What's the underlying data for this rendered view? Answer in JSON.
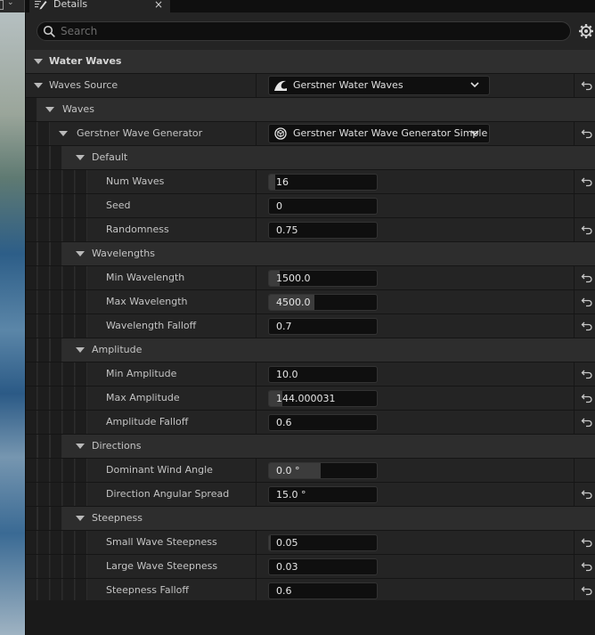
{
  "tab": {
    "title": "Details",
    "close": "×"
  },
  "search": {
    "placeholder": "Search"
  },
  "categories": {
    "water_waves": "Water Waves",
    "waves": "Waves",
    "default": "Default",
    "wavelengths": "Wavelengths",
    "amplitude": "Amplitude",
    "directions": "Directions",
    "steepness": "Steepness"
  },
  "waves_source": {
    "label": "Waves Source",
    "value": "Gerstner Water Waves"
  },
  "wave_generator": {
    "label": "Gerstner Wave Generator",
    "value": "Gerstner Water Wave Generator Simple"
  },
  "props": {
    "num_waves": {
      "label": "Num Waves",
      "value": "16",
      "fill": 0.06
    },
    "seed": {
      "label": "Seed",
      "value": "0",
      "fill": 0
    },
    "randomness": {
      "label": "Randomness",
      "value": "0.75",
      "fill": 0
    },
    "min_wavelength": {
      "label": "Min Wavelength",
      "value": "1500.0",
      "fill": 0.1
    },
    "max_wavelength": {
      "label": "Max Wavelength",
      "value": "4500.0",
      "fill": 0.42
    },
    "wavelength_falloff": {
      "label": "Wavelength Falloff",
      "value": "0.7",
      "fill": 0
    },
    "min_amplitude": {
      "label": "Min Amplitude",
      "value": "10.0",
      "fill": 0
    },
    "max_amplitude": {
      "label": "Max Amplitude",
      "value": "144.000031",
      "fill": 0.12
    },
    "amplitude_falloff": {
      "label": "Amplitude Falloff",
      "value": "0.6",
      "fill": 0
    },
    "dominant_wind_angle": {
      "label": "Dominant Wind Angle",
      "value": "0.0 °",
      "fill": 0.48
    },
    "direction_angular_spread": {
      "label": "Direction Angular Spread",
      "value": "15.0 °",
      "fill": 0
    },
    "small_wave_steepness": {
      "label": "Small Wave Steepness",
      "value": "0.05",
      "fill": 0.02
    },
    "large_wave_steepness": {
      "label": "Large Wave Steepness",
      "value": "0.03",
      "fill": 0
    },
    "steepness_falloff": {
      "label": "Steepness Falloff",
      "value": "0.6",
      "fill": 0
    }
  },
  "colors": {
    "panel_bg": "#242424",
    "category_bg": "#2f2f2f",
    "field_bg": "#0f0f0f",
    "text": "#c4c4c4"
  }
}
